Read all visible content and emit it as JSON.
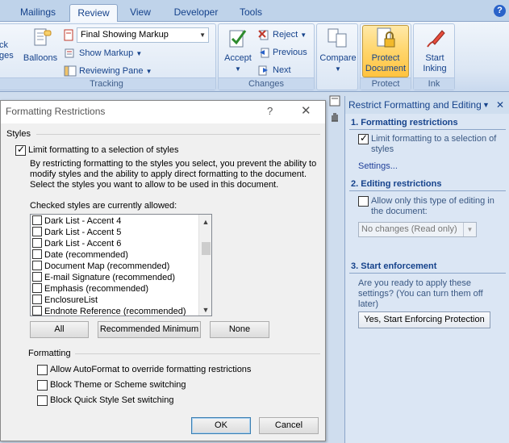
{
  "ribbon": {
    "tabs": [
      "Mailings",
      "Review",
      "View",
      "Developer",
      "Tools"
    ],
    "active_tab": "Review",
    "tracking": {
      "partial_left_label_1": "ck",
      "partial_left_label_2": "ges",
      "balloons_label": "Balloons",
      "markup_combo_value": "Final Showing Markup",
      "show_markup_label": "Show Markup",
      "reviewing_pane_label": "Reviewing Pane",
      "group_label": "Tracking"
    },
    "changes": {
      "accept_label": "Accept",
      "reject_label": "Reject",
      "previous_label": "Previous",
      "next_label": "Next",
      "group_label": "Changes"
    },
    "compare": {
      "compare_label": "Compare"
    },
    "protect": {
      "protect_document_line1": "Protect",
      "protect_document_line2": "Document",
      "group_label": "Protect"
    },
    "ink": {
      "start_inking_line1": "Start",
      "start_inking_line2": "Inking",
      "group_label": "Ink"
    }
  },
  "dialog": {
    "title": "Formatting Restrictions",
    "help_glyph": "?",
    "close_glyph": "✕",
    "styles_section": "Styles",
    "limit_formatting_label": "Limit formatting to a selection of styles",
    "limit_formatting_checked": true,
    "description_lines": [
      "By restricting formatting to the styles you select, you prevent the ability to",
      "modify styles and the ability to apply direct formatting to the document.",
      "Select the styles you want to allow to be used in this document."
    ],
    "allowed_label": "Checked styles are currently allowed:",
    "styles_list": [
      "Dark List - Accent 4",
      "Dark List - Accent 5",
      "Dark List - Accent 6",
      "Date (recommended)",
      "Document Map (recommended)",
      "E-mail Signature (recommended)",
      "Emphasis (recommended)",
      "EnclosureList",
      "Endnote Reference (recommended)"
    ],
    "all_button": "All",
    "recommended_minimum_button": "Recommended Minimum",
    "none_button": "None",
    "formatting_section": "Formatting",
    "formatting_options": [
      "Allow AutoFormat to override formatting restrictions",
      "Block Theme or Scheme switching",
      "Block Quick Style Set switching"
    ],
    "ok_button": "OK",
    "cancel_button": "Cancel"
  },
  "task_pane": {
    "title": "Restrict Formatting and Editing",
    "section1_heading": "1. Formatting restrictions",
    "section1_checkbox_line1": "Limit formatting to a selection of",
    "section1_checkbox_line2": "styles",
    "section1_checked": true,
    "settings_link": "Settings...",
    "section2_heading": "2. Editing restrictions",
    "section2_checkbox_line1": "Allow only this type of editing in",
    "section2_checkbox_line2": "the document:",
    "section2_checked": false,
    "editing_type_value": "No changes (Read only)",
    "section3_heading": "3. Start enforcement",
    "enforcement_text_lines": [
      "Are you ready to apply these",
      "settings? (You can turn them off",
      "later)"
    ],
    "start_enforcing_button": "Yes, Start Enforcing Protection"
  },
  "colors": {
    "ribbon_text": "#15428b",
    "protect_highlight": "#ffd56b",
    "pane_background": "#dbe6f4"
  }
}
